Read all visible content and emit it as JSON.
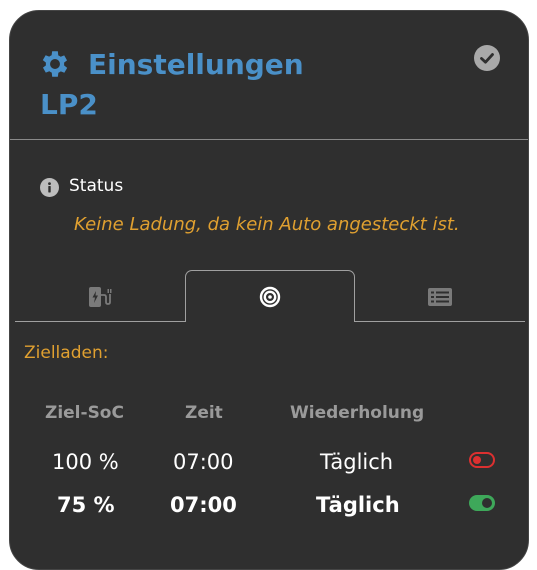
{
  "header": {
    "title": "Einstellungen",
    "subtitle": "LP2",
    "title_color": "#4a90c8"
  },
  "status": {
    "label": "Status",
    "message": "Keine Ladung, da kein Auto angesteckt ist.",
    "message_color": "#e0a030"
  },
  "tabs": [
    {
      "icon": "charging-station-icon",
      "active": false
    },
    {
      "icon": "target-icon",
      "active": true
    },
    {
      "icon": "list-icon",
      "active": false
    }
  ],
  "section": {
    "title": "Zielladen:"
  },
  "table": {
    "headers": [
      "Ziel-SoC",
      "Zeit",
      "Wiederholung"
    ],
    "rows": [
      {
        "soc": "100 %",
        "time": "07:00",
        "repeat": "Täglich",
        "enabled": false,
        "emphasized": false
      },
      {
        "soc": "75 %",
        "time": "07:00",
        "repeat": "Täglich",
        "enabled": true,
        "emphasized": true
      }
    ]
  },
  "colors": {
    "background": "#2f2f2f",
    "accent_orange": "#e0a030",
    "toggle_off": "#dc3030",
    "toggle_on": "#3ea85a"
  }
}
